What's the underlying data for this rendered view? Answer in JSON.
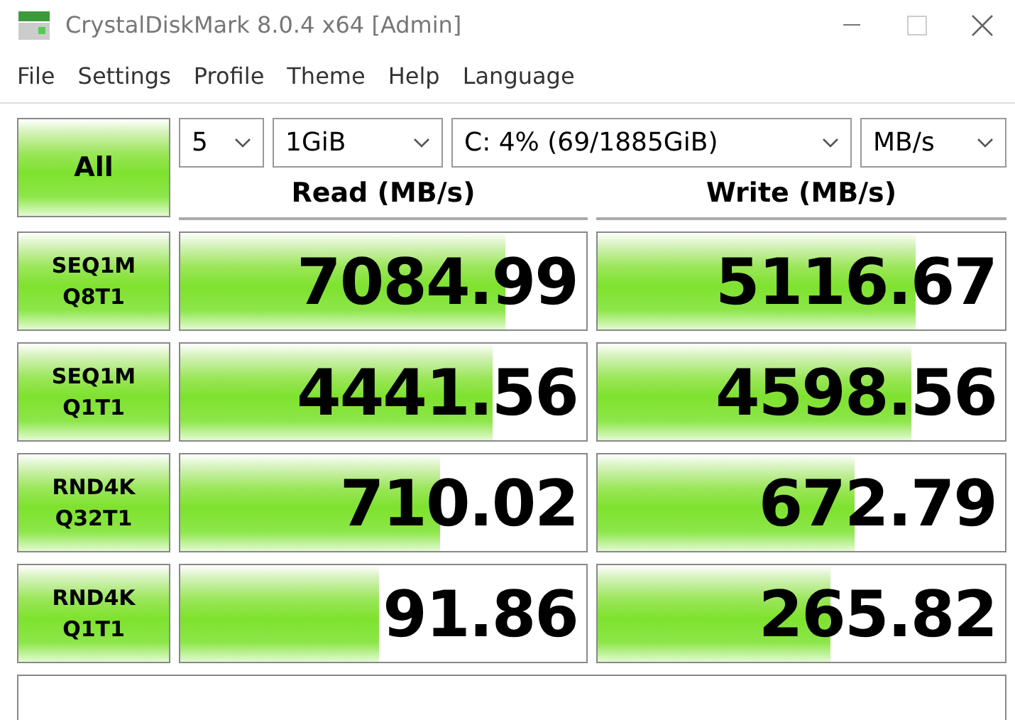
{
  "window": {
    "title": "CrystalDiskMark 8.0.4 x64 [Admin]"
  },
  "menu": [
    "File",
    "Settings",
    "Profile",
    "Theme",
    "Help",
    "Language"
  ],
  "all_button": "All",
  "selectors": [
    {
      "value": "5"
    },
    {
      "value": "1GiB"
    },
    {
      "value": "C: 4% (69/1885GiB)"
    },
    {
      "value": "MB/s"
    }
  ],
  "headers": [
    "Read (MB/s)",
    "Write (MB/s)"
  ],
  "tests": [
    {
      "line1": "SEQ1M",
      "line2": "Q8T1",
      "read": {
        "value": "7084.99",
        "level": 0.8
      },
      "write": {
        "value": "5116.67",
        "level": 0.78
      }
    },
    {
      "line1": "SEQ1M",
      "line2": "Q1T1",
      "read": {
        "value": "4441.56",
        "level": 0.77
      },
      "write": {
        "value": "4598.56",
        "level": 0.77
      }
    },
    {
      "line1": "RND4K",
      "line2": "Q32T1",
      "read": {
        "value": "710.02",
        "level": 0.64
      },
      "write": {
        "value": "672.79",
        "level": 0.63
      }
    },
    {
      "line1": "RND4K",
      "line2": "Q1T1",
      "read": {
        "value": "91.86",
        "level": 0.49
      },
      "write": {
        "value": "265.82",
        "level": 0.57
      }
    }
  ]
}
